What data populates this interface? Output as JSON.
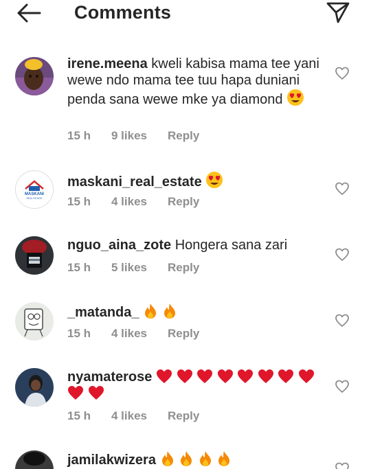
{
  "header": {
    "title": "Comments",
    "back_icon": "arrow-left-icon",
    "send_icon": "paper-plane-icon"
  },
  "comments": [
    {
      "username": "irene.meena",
      "text": "kweli kabisa mama tee yani wewe ndo mama tee tuu hapa duniani penda sana wewe mke ya diamond",
      "emoji": "heart-eyes-emoji",
      "time": "15 h",
      "likes": "9 likes",
      "reply": "Reply"
    },
    {
      "username": "maskani_real_estate",
      "text": "",
      "emoji": "heart-eyes-emoji",
      "time": "15 h",
      "likes": "4 likes",
      "reply": "Reply",
      "avatar_logo_line1": "MASKANI",
      "avatar_logo_line2": "REAL ESTATE"
    },
    {
      "username": "nguo_aina_zote",
      "text": "Hongera sana zari",
      "time": "15 h",
      "likes": "5 likes",
      "reply": "Reply"
    },
    {
      "username": "_matanda_",
      "text": "",
      "emoji": "fire-emoji x2",
      "time": "15 h",
      "likes": "4 likes",
      "reply": "Reply"
    },
    {
      "username": "nyamaterose",
      "text": "",
      "emoji": "red-heart-emoji x10",
      "time": "15 h",
      "likes": "4 likes",
      "reply": "Reply"
    },
    {
      "username": "jamilakwizera",
      "text": "",
      "emoji": "fire-emoji x4"
    }
  ],
  "colors": {
    "text": "#262626",
    "meta": "#8e8e8e",
    "heart_red": "#e0162b",
    "fire_orange": "#f58a07"
  }
}
